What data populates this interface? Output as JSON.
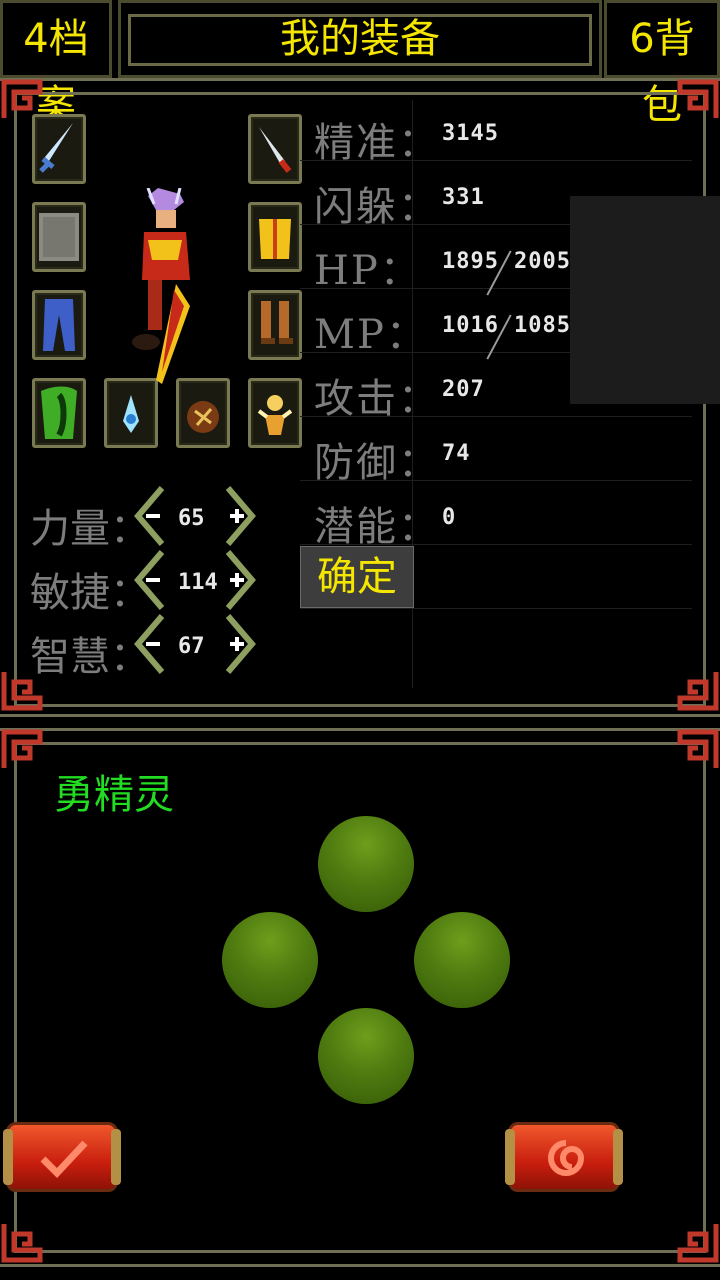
{
  "header": {
    "left_tab": "4档案",
    "title": "我的装备",
    "right_tab": "6背包"
  },
  "stats": [
    {
      "label": "精准：",
      "value": "3145"
    },
    {
      "label": "闪躲：",
      "value": "331"
    },
    {
      "label": "HP：",
      "value": "1895",
      "max": "2005"
    },
    {
      "label": "MP：",
      "value": "1016",
      "max": "1085"
    },
    {
      "label": "攻击：",
      "value": "207"
    },
    {
      "label": "防御：",
      "value": "74"
    },
    {
      "label": "潜能：",
      "value": "0"
    }
  ],
  "confirm_label": "确定",
  "attributes": [
    {
      "label": "力量：",
      "value": "65"
    },
    {
      "label": "敏捷：",
      "value": "114"
    },
    {
      "label": "智慧：",
      "value": "67"
    }
  ],
  "spirit": {
    "name": "勇精灵",
    "color": "#22dd22"
  },
  "equipment_slots": [
    {
      "icon": "sword-icon"
    },
    {
      "icon": "stone-icon"
    },
    {
      "icon": "pants-icon"
    },
    {
      "icon": "cloak-icon"
    },
    {
      "icon": "knife-icon"
    },
    {
      "icon": "armor-icon"
    },
    {
      "icon": "boots-icon"
    },
    {
      "icon": "crystal-icon"
    },
    {
      "icon": "bag-icon"
    },
    {
      "icon": "pet-icon"
    }
  ],
  "colors": {
    "title": "#f4e600",
    "frame": "#6f6f55",
    "orb": "#4f7b10",
    "button": "#c81e0e"
  }
}
